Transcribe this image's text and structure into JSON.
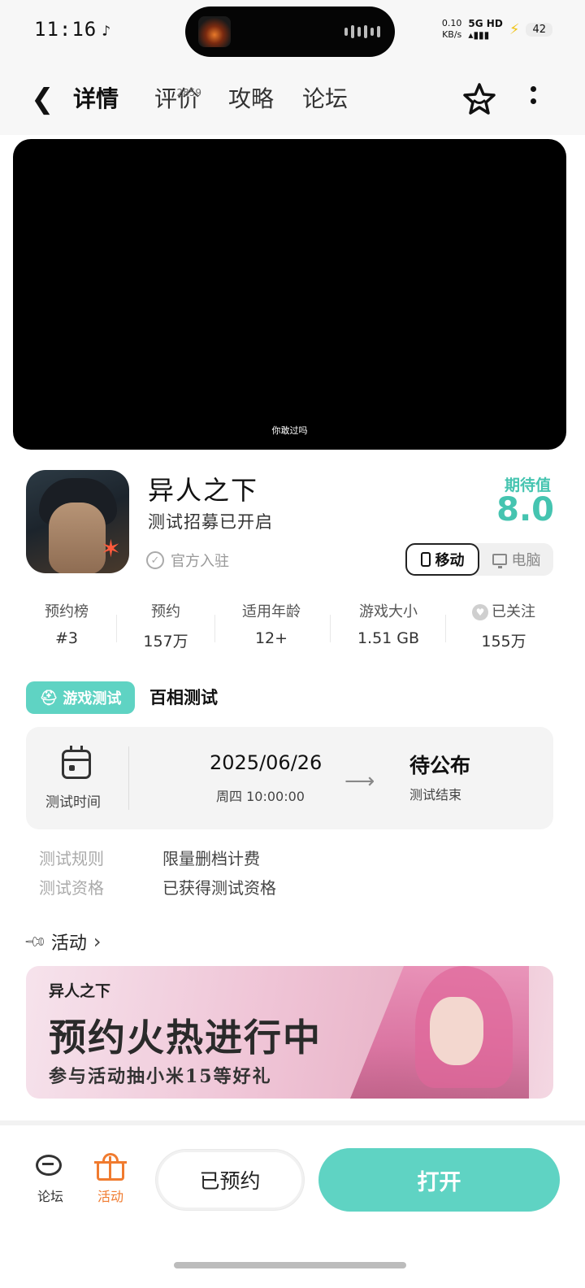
{
  "status": {
    "time": "11:16",
    "speed_top": "0.10",
    "speed_unit": "KB/s",
    "network": "5G HD",
    "battery": "42"
  },
  "nav": {
    "tabs": [
      {
        "label": "详情",
        "active": true
      },
      {
        "label": "评价",
        "count": "2859"
      },
      {
        "label": "攻略"
      },
      {
        "label": "论坛"
      }
    ]
  },
  "video": {
    "subtitle": "你敢过吗"
  },
  "game": {
    "title": "异人之下",
    "status": "测试招募已开启",
    "official": "官方入驻",
    "expect_label": "期待值",
    "expect_score": "8.0",
    "platforms": {
      "mobile": "移动",
      "pc": "电脑",
      "selected": "mobile"
    }
  },
  "stats": [
    {
      "label": "预约榜",
      "value": "#3"
    },
    {
      "label": "预约",
      "value": "157万"
    },
    {
      "label": "适用年龄",
      "value": "12+"
    },
    {
      "label": "游戏大小",
      "value": "1.51 GB"
    },
    {
      "label": "已关注",
      "value": "155万"
    }
  ],
  "test": {
    "badge": "游戏测试",
    "name": "百相测试",
    "time_label": "测试时间",
    "date": "2025/06/26",
    "weekday_time": "周四  10:00:00",
    "end_status": "待公布",
    "end_label": "测试结束",
    "rules": [
      {
        "key": "测试规则",
        "value": "限量删档计费"
      },
      {
        "key": "测试资格",
        "value": "已获得测试资格"
      }
    ]
  },
  "activity": {
    "header": "活动",
    "banner_logo": "异人之下",
    "banner_title": "预约火热进行中",
    "banner_sub": "参与活动抽小米15等好礼"
  },
  "bottom": {
    "forum": "论坛",
    "activity": "活动",
    "reserved": "已预约",
    "open": "打开"
  },
  "colors": {
    "accent": "#5fd3c3",
    "activity_orange": "#f07b2f",
    "score": "#45c4b0"
  }
}
